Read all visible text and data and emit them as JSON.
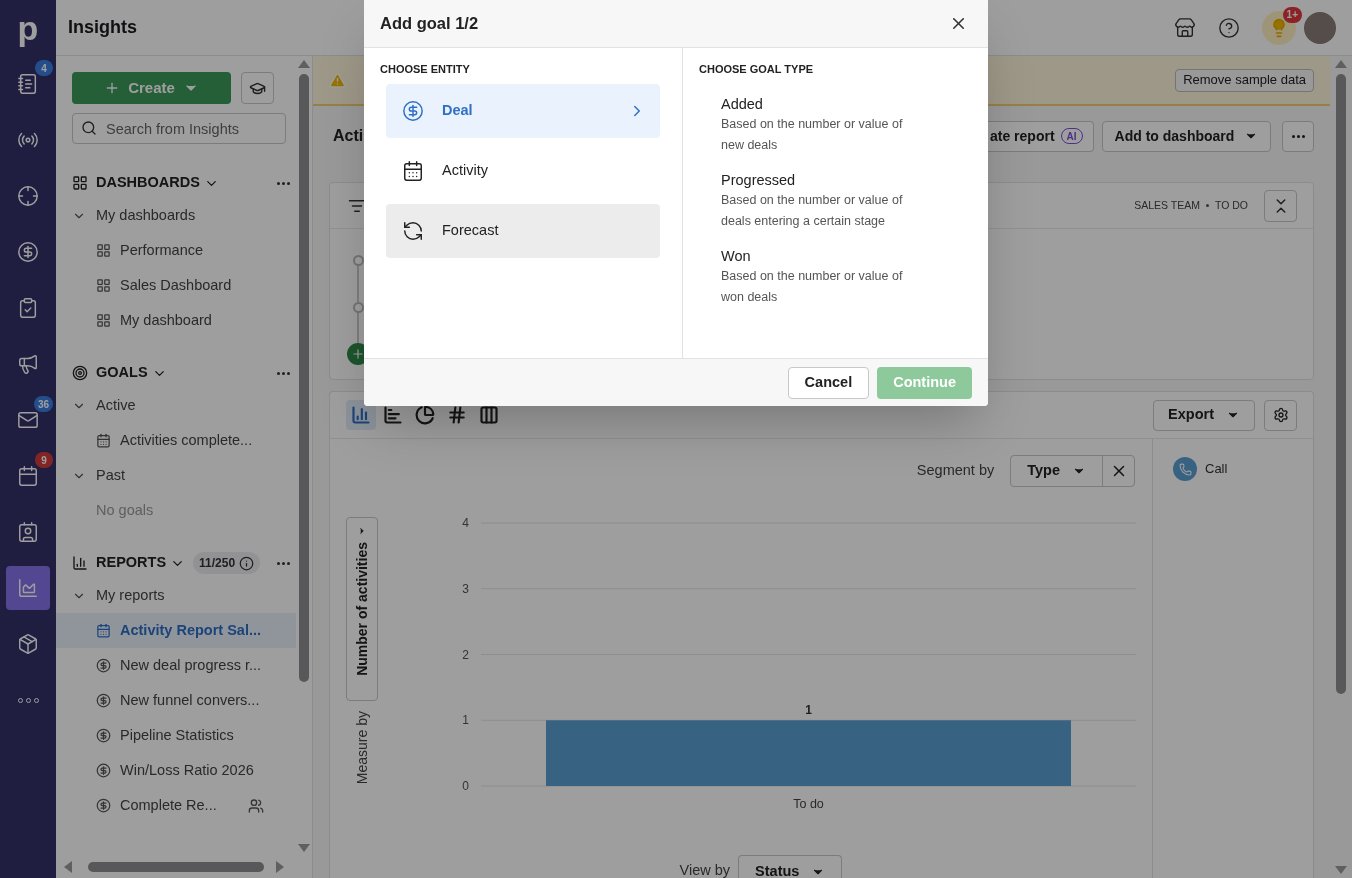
{
  "nav_rail": {
    "logo": "p",
    "items": [
      {
        "kind": "leads",
        "badge": "4",
        "urgent": false,
        "selected": false
      },
      {
        "kind": "signal",
        "selected": false
      },
      {
        "kind": "target",
        "selected": false
      },
      {
        "kind": "deals",
        "selected": false
      },
      {
        "kind": "tasks",
        "selected": false
      },
      {
        "kind": "campaigns",
        "selected": false
      },
      {
        "kind": "mail",
        "badge": "36",
        "urgent": false,
        "selected": false
      },
      {
        "kind": "calendar",
        "badge": "9",
        "urgent": true,
        "selected": false
      },
      {
        "kind": "contacts",
        "selected": false
      },
      {
        "kind": "insights",
        "selected": true
      },
      {
        "kind": "products",
        "selected": false
      },
      {
        "kind": "more",
        "selected": false
      }
    ]
  },
  "top_bar": {
    "title": "Insights",
    "tips_badge": "1+"
  },
  "sidebar": {
    "create_label": "Create",
    "search_placeholder": "Search from Insights",
    "sections": [
      {
        "kind": "dashboards",
        "title": "DASHBOARDS",
        "groups": [
          {
            "label": "My dashboards",
            "expanded": true,
            "items": [
              {
                "kind": "dashboard",
                "label": "Performance",
                "selected": false,
                "shared": false
              },
              {
                "kind": "dashboard",
                "label": "Sales Dashboard",
                "selected": false,
                "shared": false
              },
              {
                "kind": "dashboard",
                "label": "My dashboard",
                "selected": false,
                "shared": false
              }
            ]
          }
        ]
      },
      {
        "kind": "goals",
        "title": "GOALS",
        "groups": [
          {
            "label": "Active",
            "expanded": true,
            "items": [
              {
                "kind": "activity",
                "label": "Activities complete...",
                "selected": false,
                "shared": false
              }
            ]
          },
          {
            "label": "Past",
            "expanded": true,
            "items": [
              {
                "kind": "empty",
                "label": "No goals",
                "selected": false,
                "shared": false
              }
            ]
          }
        ]
      },
      {
        "kind": "reports",
        "title": "REPORTS",
        "count": "11/250",
        "groups": [
          {
            "label": "My reports",
            "expanded": true,
            "items": [
              {
                "kind": "activity",
                "label": "Activity Report Sal...",
                "selected": true,
                "shared": false
              },
              {
                "kind": "deal",
                "label": "New deal progress r...",
                "selected": false,
                "shared": false
              },
              {
                "kind": "deal",
                "label": "New funnel convers...",
                "selected": false,
                "shared": false
              },
              {
                "kind": "deal",
                "label": "Pipeline Statistics",
                "selected": false,
                "shared": false
              },
              {
                "kind": "deal",
                "label": "Win/Loss Ratio 2026",
                "selected": false,
                "shared": false
              },
              {
                "kind": "deal",
                "label": "Complete Re...",
                "selected": false,
                "shared": true
              }
            ]
          }
        ]
      }
    ]
  },
  "banner": {
    "button": "Remove sample data"
  },
  "report_header": {
    "title": "Acti",
    "generate_button": "ate report",
    "ai_badge": "AI",
    "add_button": "Add to dashboard"
  },
  "filters": {
    "tags": [
      "SALES TEAM",
      "TO DO"
    ]
  },
  "chart_panel": {
    "chart_types": [
      {
        "kind": "column",
        "selected": true
      },
      {
        "kind": "bar",
        "selected": false
      },
      {
        "kind": "pie",
        "selected": false
      },
      {
        "kind": "number",
        "selected": false
      },
      {
        "kind": "table",
        "selected": false
      }
    ],
    "export_button": "Export",
    "segment_label": "Segment by",
    "segment_value": "Type",
    "measure_label": "Measure by",
    "measure_value": "Number of activities",
    "view_label": "View by",
    "view_value": "Status",
    "chart_data": {
      "type": "bar",
      "categories": [
        "To do"
      ],
      "series": [
        {
          "name": "Call",
          "color": "#5b9fd1",
          "values": [
            1
          ]
        }
      ],
      "ylim": [
        0,
        4
      ],
      "yticks": [
        0,
        1,
        2,
        3,
        4
      ],
      "grid": true,
      "data_labels": true
    }
  },
  "modal": {
    "title": "Add goal 1/2",
    "entity_heading": "CHOOSE ENTITY",
    "entities": [
      {
        "kind": "deal",
        "label": "Deal",
        "selected": true,
        "hovered": false
      },
      {
        "kind": "activity",
        "label": "Activity",
        "selected": false,
        "hovered": false
      },
      {
        "kind": "forecast",
        "label": "Forecast",
        "selected": false,
        "hovered": true
      }
    ],
    "type_heading": "CHOOSE GOAL TYPE",
    "goal_types": [
      {
        "title": "Added",
        "description": "Based on the number or value of new deals"
      },
      {
        "title": "Progressed",
        "description": "Based on the number or value of deals entering a certain stage"
      },
      {
        "title": "Won",
        "description": "Based on the number or value of won deals"
      }
    ],
    "cancel": "Cancel",
    "continue": "Continue",
    "continue_disabled": true
  }
}
